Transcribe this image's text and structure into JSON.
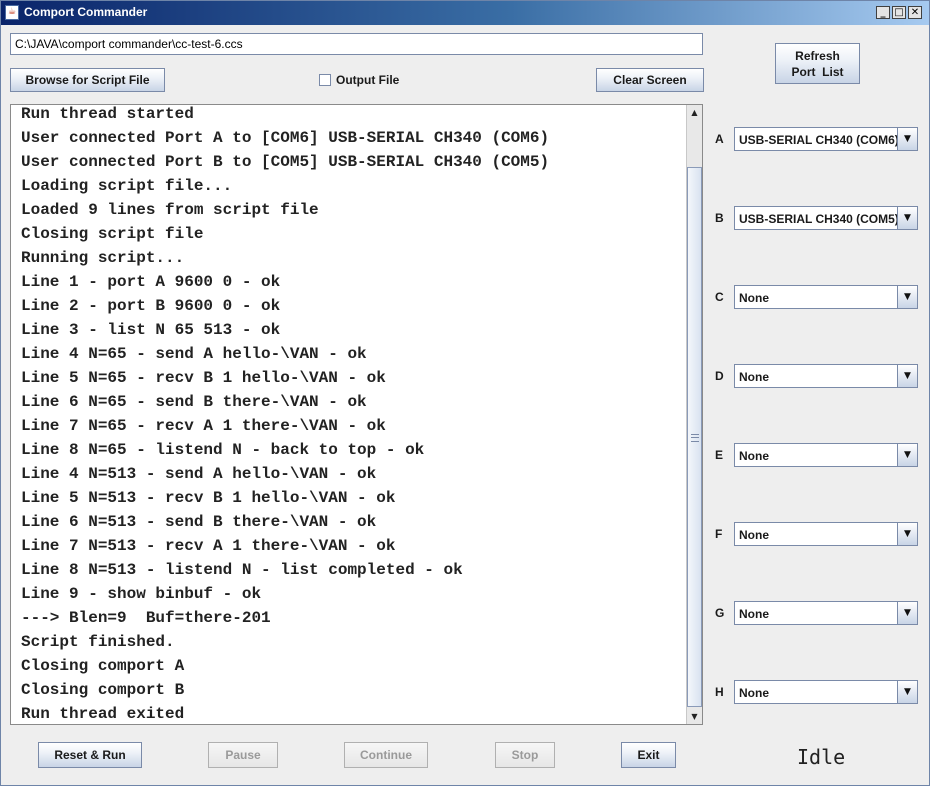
{
  "window": {
    "title": "Comport Commander",
    "controls": {
      "minimize": "_",
      "maximize": "□",
      "close": "✕"
    }
  },
  "script_path": "C:\\JAVA\\comport commander\\cc-test-6.ccs",
  "toolbar": {
    "browse_label": "Browse for Script File",
    "output_file_label": "Output File",
    "output_file_checked": false,
    "clear_label": "Clear Screen",
    "refresh_line1": "Refresh",
    "refresh_line2": "Port  List"
  },
  "console": {
    "lines": [
      "Run thread started",
      "User connected Port A to [COM6] USB-SERIAL CH340 (COM6)",
      "User connected Port B to [COM5] USB-SERIAL CH340 (COM5)",
      "Loading script file...",
      "Loaded 9 lines from script file",
      "Closing script file",
      "Running script...",
      "Line 1 - port A 9600 0 - ok",
      "Line 2 - port B 9600 0 - ok",
      "Line 3 - list N 65 513 - ok",
      "Line 4 N=65 - send A hello-\\VAN - ok",
      "Line 5 N=65 - recv B 1 hello-\\VAN - ok",
      "Line 6 N=65 - send B there-\\VAN - ok",
      "Line 7 N=65 - recv A 1 there-\\VAN - ok",
      "Line 8 N=65 - listend N - back to top - ok",
      "Line 4 N=513 - send A hello-\\VAN - ok",
      "Line 5 N=513 - recv B 1 hello-\\VAN - ok",
      "Line 6 N=513 - send B there-\\VAN - ok",
      "Line 7 N=513 - recv A 1 there-\\VAN - ok",
      "Line 8 N=513 - listend N - list completed - ok",
      "Line 9 - show binbuf - ok",
      "---> Blen=9  Buf=there-201",
      "Script finished.",
      "Closing comport A",
      "Closing comport B",
      "Run thread exited"
    ]
  },
  "ports": [
    {
      "label": "A",
      "value": "USB-SERIAL CH340 (COM6)"
    },
    {
      "label": "B",
      "value": "USB-SERIAL CH340 (COM5)"
    },
    {
      "label": "C",
      "value": "None"
    },
    {
      "label": "D",
      "value": "None"
    },
    {
      "label": "E",
      "value": "None"
    },
    {
      "label": "F",
      "value": "None"
    },
    {
      "label": "G",
      "value": "None"
    },
    {
      "label": "H",
      "value": "None"
    }
  ],
  "controls": {
    "reset_run": "Reset & Run",
    "pause": "Pause",
    "continue": "Continue",
    "stop": "Stop",
    "exit": "Exit"
  },
  "status": "Idle",
  "icons": {
    "dropdown": "chevron-down-icon",
    "scroll_up": "arrow-up-icon",
    "scroll_down": "arrow-down-icon"
  }
}
